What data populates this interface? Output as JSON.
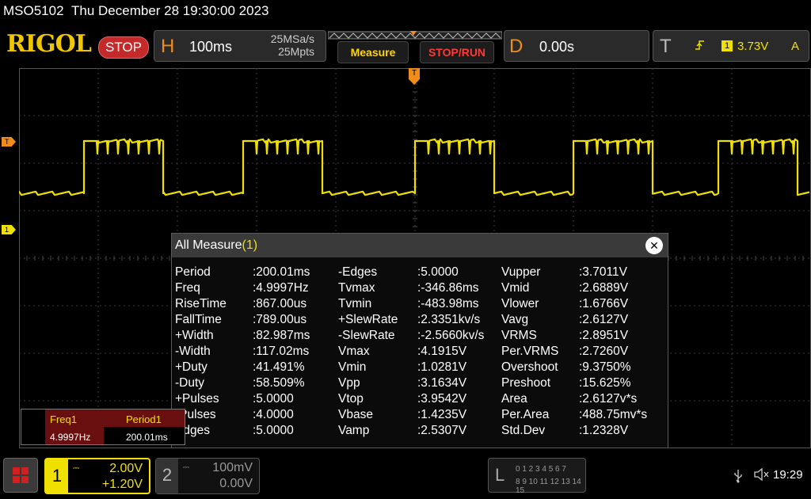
{
  "status_line": {
    "model": "MSO5102",
    "datetime": "Thu December 28 19:30:00 2023"
  },
  "brand": {
    "logo": "RIGOL",
    "run_state": "STOP"
  },
  "horizontal": {
    "letter": "H",
    "timebase": "100ms",
    "sample_rate": "25MSa/s",
    "memory_depth": "25Mpts"
  },
  "buttons": {
    "measure": "Measure",
    "stop_run": "STOP/RUN"
  },
  "delay": {
    "letter": "D",
    "value": "0.00s"
  },
  "trigger": {
    "letter": "T",
    "source": "1",
    "level": "3.73V",
    "mode": "A"
  },
  "markers": {
    "trigger_level": "T",
    "channel1": "1",
    "trigger_position": "T"
  },
  "measure_panel": {
    "title": "All Measure",
    "channel": "(1)",
    "close_label": "✕",
    "columns": [
      [
        {
          "name": "Period",
          "value": ":200.01ms"
        },
        {
          "name": "Freq",
          "value": ":4.9997Hz"
        },
        {
          "name": "RiseTime",
          "value": ":867.00us"
        },
        {
          "name": "FallTime",
          "value": ":789.00us"
        },
        {
          "name": "+Width",
          "value": ":82.987ms"
        },
        {
          "name": "-Width",
          "value": ":117.02ms"
        },
        {
          "name": "+Duty",
          "value": ":41.491%"
        },
        {
          "name": "-Duty",
          "value": ":58.509%"
        },
        {
          "name": "+Pulses",
          "value": ":5.0000"
        },
        {
          "name": "-Pulses",
          "value": ":4.0000"
        },
        {
          "name": "Edges",
          "value": ":5.0000"
        }
      ],
      [
        {
          "name": "-Edges",
          "value": ":5.0000"
        },
        {
          "name": "Tvmax",
          "value": ":-346.86ms"
        },
        {
          "name": "Tvmin",
          "value": ":-483.98ms"
        },
        {
          "name": "+SlewRate",
          "value": ":2.3351kv/s"
        },
        {
          "name": "-SlewRate",
          "value": ":-2.5660kv/s"
        },
        {
          "name": "Vmax",
          "value": ":4.1915V"
        },
        {
          "name": "Vmin",
          "value": ":1.0281V"
        },
        {
          "name": "Vpp",
          "value": ":3.1634V"
        },
        {
          "name": "Vtop",
          "value": ":3.9542V"
        },
        {
          "name": "Vbase",
          "value": ":1.4235V"
        },
        {
          "name": "Vamp",
          "value": ":2.5307V"
        }
      ],
      [
        {
          "name": "Vupper",
          "value": ":3.7011V"
        },
        {
          "name": "Vmid",
          "value": ":2.6889V"
        },
        {
          "name": "Vlower",
          "value": ":1.6766V"
        },
        {
          "name": "Vavg",
          "value": ":2.6127V"
        },
        {
          "name": "VRMS",
          "value": ":2.8951V"
        },
        {
          "name": "Per.VRMS",
          "value": ":2.7260V"
        },
        {
          "name": "Overshoot",
          "value": ":9.3750%"
        },
        {
          "name": "Preshoot",
          "value": ":15.625%"
        },
        {
          "name": "Area",
          "value": ":2.6127v*s"
        },
        {
          "name": "Per.Area",
          "value": ":488.75mv*s"
        },
        {
          "name": "Std.Dev",
          "value": ":1.2328V"
        }
      ]
    ]
  },
  "stats": [
    {
      "name": "Freq1",
      "value": "4.9997Hz"
    },
    {
      "name": "Period1",
      "value": "200.01ms"
    }
  ],
  "channels": {
    "ch1": {
      "number": "1",
      "scale": "2.00V",
      "offset": "+1.20V"
    },
    "ch2": {
      "number": "2",
      "scale": "100mV",
      "offset": "0.00V"
    }
  },
  "logic_analyzer": {
    "letter": "L",
    "row1": "0 1 2 3   4 5 6 7",
    "row2": "8 9 10 11  12 13 14 15"
  },
  "system": {
    "time": "19:29",
    "usb_icon": "usb-icon",
    "speaker_icon": "speaker-muted-icon"
  },
  "colors": {
    "ch1": "#f0e000",
    "accent": "#f08c1a",
    "stop": "#c42a2a",
    "measure": "#ffd400"
  }
}
